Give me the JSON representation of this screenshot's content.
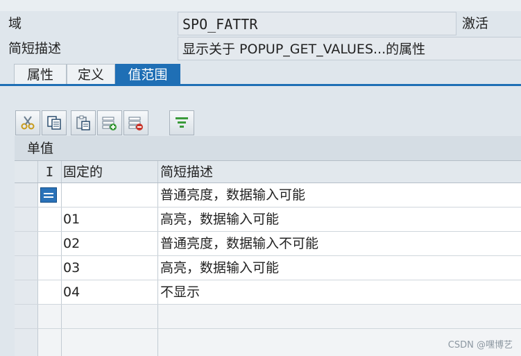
{
  "header": {
    "domain_label": "域",
    "domain_value": "SPO_FATTR",
    "status": "激活",
    "short_desc_label": "简短描述",
    "short_desc_value": "显示关于 POPUP_GET_VALUES...的属性"
  },
  "tabs": [
    {
      "label": "属性",
      "active": false
    },
    {
      "label": "定义",
      "active": false
    },
    {
      "label": "值范围",
      "active": true
    }
  ],
  "toolbar": [
    {
      "icon": "cut-icon"
    },
    {
      "icon": "copy-icon"
    },
    {
      "icon": "paste-icon"
    },
    {
      "icon": "insert-row-icon"
    },
    {
      "icon": "delete-row-icon"
    },
    {
      "icon": "filter-icon"
    }
  ],
  "grid": {
    "title": "单值",
    "columns": {
      "i": "I",
      "value": "固定的",
      "desc": "简短描述"
    },
    "rows": [
      {
        "value": "",
        "desc": "普通亮度，数据输入可能"
      },
      {
        "value": "01",
        "desc": "高亮，数据输入可能"
      },
      {
        "value": "02",
        "desc": "普通亮度，数据输入不可能"
      },
      {
        "value": "03",
        "desc": "高亮，数据输入可能"
      },
      {
        "value": "04",
        "desc": "不显示"
      }
    ]
  },
  "watermark": "CSDN @嘿博艺"
}
